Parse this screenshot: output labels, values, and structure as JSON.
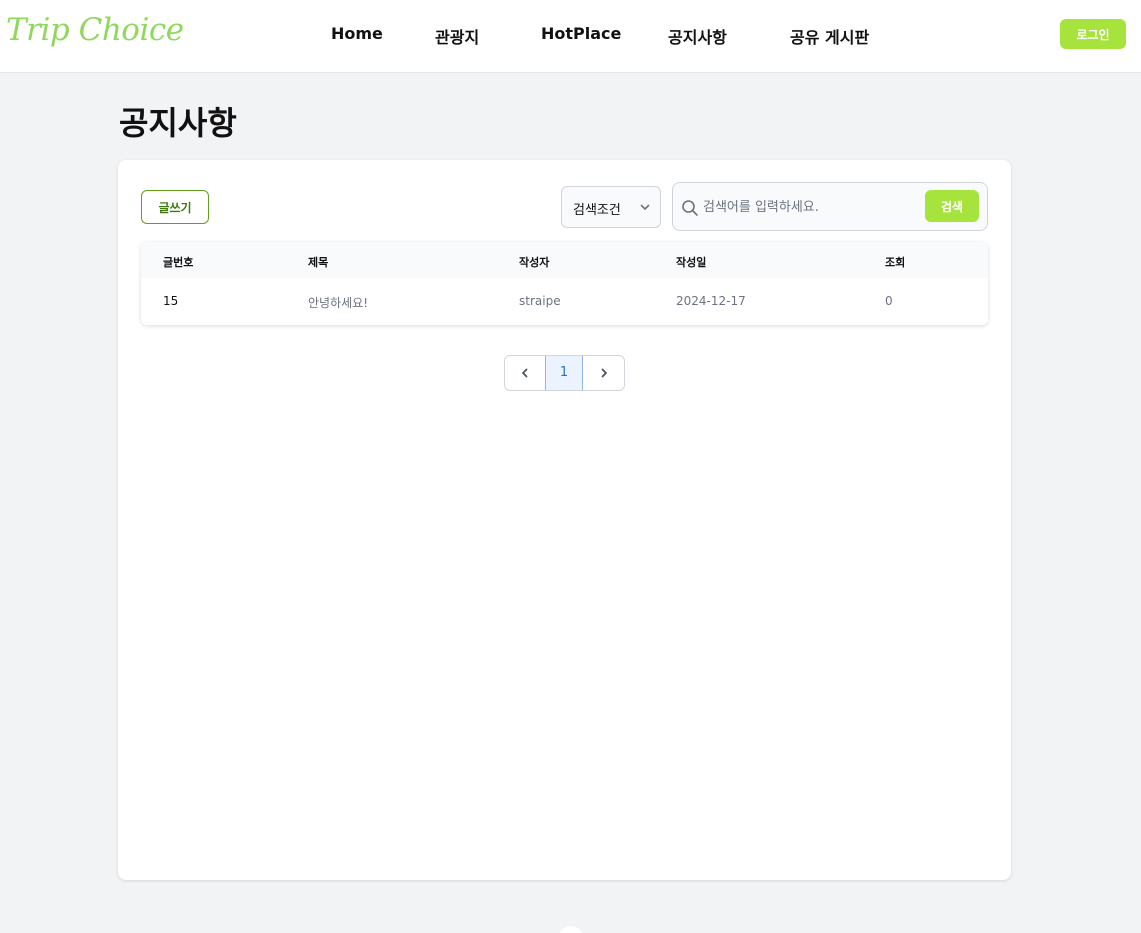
{
  "header": {
    "logo": "Trip Choice",
    "nav": [
      "Home",
      "관광지",
      "HotPlace",
      "공지사항",
      "공유 게시판"
    ],
    "login_label": "로그인"
  },
  "page": {
    "title": "공지사항"
  },
  "toolbar": {
    "write_label": "글쓰기",
    "select_label": "검색조건",
    "search_placeholder": "검색어를 입력하세요.",
    "search_label": "검색"
  },
  "table": {
    "columns": [
      "글번호",
      "제목",
      "작성자",
      "작성일",
      "조회"
    ],
    "rows": [
      {
        "no": "15",
        "title": "안녕하세요!",
        "author": "straipe",
        "date": "2024-12-17",
        "views": "0"
      }
    ]
  },
  "pagination": {
    "current_page": "1"
  },
  "colors": {
    "accent": "#a6e33c",
    "logo": "#8ed85a",
    "write_border": "#62a21b"
  }
}
